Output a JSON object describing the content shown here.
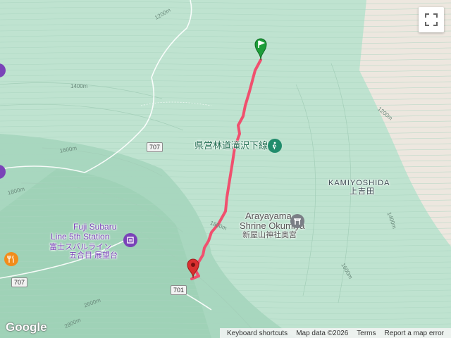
{
  "map": {
    "places": {
      "fuji_subaru_en_1": "Fuji Subaru",
      "fuji_subaru_en_2": "Line 5th Station",
      "fuji_subaru_ja": "富士スバルライン",
      "fuji_subaru_ja_2": "五合目 展望台",
      "arayayama_en_1": "Arayayama",
      "arayayama_en_2": "Shrine Okumiya",
      "arayayama_ja": "新屋山神社奥宮",
      "forest_road_ja": "県営林道滝沢下線",
      "kamiyoshida_en": "KAMIYOSHIDA",
      "kamiyoshida_ja": "上吉田"
    },
    "elevation_labels": [
      "1200m",
      "1400m",
      "1600m",
      "1800m",
      "1200m",
      "1400m",
      "1600m",
      "1800m",
      "2600m",
      "2800m"
    ],
    "route_numbers": [
      "707",
      "707",
      "701"
    ],
    "colors": {
      "terrain": "#bfe3d0",
      "urban": "#ede7df",
      "route": "#f0506e",
      "start_marker": "#1e9e3a",
      "end_marker": "#d93030"
    },
    "icons": [
      "fullscreen-icon",
      "hiking-icon",
      "shrine-icon",
      "restaurant-icon",
      "start-flag-icon",
      "end-pin-icon"
    ]
  },
  "footer": {
    "logo": "Google",
    "keyboard_shortcuts": "Keyboard shortcuts",
    "map_data": "Map data ©2026",
    "terms": "Terms",
    "report": "Report a map error"
  }
}
